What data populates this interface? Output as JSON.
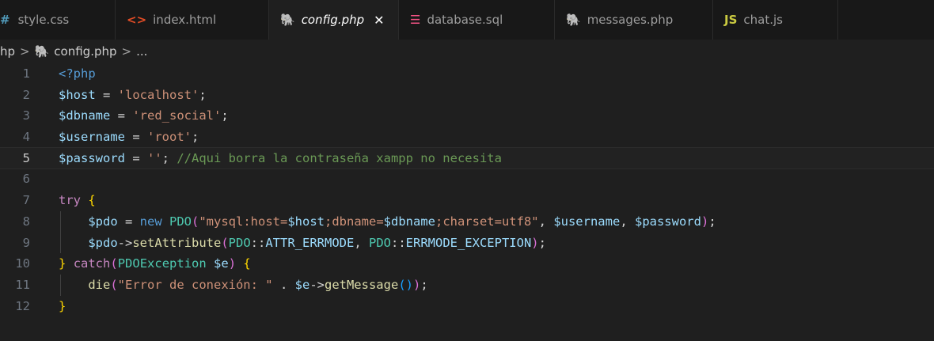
{
  "tabs": [
    {
      "label": "style.css",
      "icon": "css-hash-icon",
      "icon_text": "#",
      "icon_color": "#519aba"
    },
    {
      "label": "index.html",
      "icon": "html-brackets-icon",
      "icon_text": "<>",
      "icon_color": "#e44d26"
    },
    {
      "label": "config.php",
      "icon": "php-elephant-icon",
      "icon_text": "🐘",
      "icon_color": "#a074c4",
      "active": true,
      "close": "✕"
    },
    {
      "label": "database.sql",
      "icon": "database-icon",
      "icon_text": "☰",
      "icon_color": "#f55385"
    },
    {
      "label": "messages.php",
      "icon": "php-elephant-icon",
      "icon_text": "🐘",
      "icon_color": "#a074c4"
    },
    {
      "label": "chat.js",
      "icon": "js-icon",
      "icon_text": "JS",
      "icon_color": "#cbcb41"
    }
  ],
  "breadcrumb": {
    "parent": "hp",
    "file": "config.php",
    "tail": "...",
    "separator": ">"
  },
  "editor": {
    "current_line": 5,
    "lines": [
      {
        "n": "1",
        "t": [
          [
            "<?php",
            "kw"
          ]
        ]
      },
      {
        "n": "2",
        "t": [
          [
            "$host",
            "var"
          ],
          [
            " = ",
            "pun"
          ],
          [
            "'localhost'",
            "str"
          ],
          [
            ";",
            "pun"
          ]
        ]
      },
      {
        "n": "3",
        "t": [
          [
            "$dbname",
            "var"
          ],
          [
            " = ",
            "pun"
          ],
          [
            "'red_social'",
            "str"
          ],
          [
            ";",
            "pun"
          ]
        ]
      },
      {
        "n": "4",
        "t": [
          [
            "$username",
            "var"
          ],
          [
            " = ",
            "pun"
          ],
          [
            "'root'",
            "str"
          ],
          [
            ";",
            "pun"
          ]
        ]
      },
      {
        "n": "5",
        "t": [
          [
            "$password",
            "var"
          ],
          [
            " = ",
            "pun"
          ],
          [
            "''",
            "str"
          ],
          [
            "; ",
            "pun"
          ],
          [
            "//Aqui borra la contraseña xampp no necesita",
            "cmt"
          ]
        ]
      },
      {
        "n": "6",
        "t": []
      },
      {
        "n": "7",
        "t": [
          [
            "try",
            "ctl"
          ],
          [
            " ",
            "pun"
          ],
          [
            "{",
            "br1"
          ]
        ]
      },
      {
        "n": "8",
        "g": true,
        "t": [
          [
            "    ",
            "pun"
          ],
          [
            "$pdo",
            "var"
          ],
          [
            " = ",
            "pun"
          ],
          [
            "new",
            "kw"
          ],
          [
            " ",
            "pun"
          ],
          [
            "PDO",
            "cls"
          ],
          [
            "(",
            "br2"
          ],
          [
            "\"mysql:host=",
            "str"
          ],
          [
            "$host",
            "var"
          ],
          [
            ";dbname=",
            "str"
          ],
          [
            "$dbname",
            "var"
          ],
          [
            ";charset=utf8\"",
            "str"
          ],
          [
            ", ",
            "pun"
          ],
          [
            "$username",
            "var"
          ],
          [
            ", ",
            "pun"
          ],
          [
            "$password",
            "var"
          ],
          [
            ")",
            "br2"
          ],
          [
            ";",
            "pun"
          ]
        ]
      },
      {
        "n": "9",
        "g": true,
        "t": [
          [
            "    ",
            "pun"
          ],
          [
            "$pdo",
            "var"
          ],
          [
            "->",
            "pun"
          ],
          [
            "setAttribute",
            "fn"
          ],
          [
            "(",
            "br2"
          ],
          [
            "PDO",
            "cls"
          ],
          [
            "::",
            "pun"
          ],
          [
            "ATTR_ERRMODE",
            "var"
          ],
          [
            ", ",
            "pun"
          ],
          [
            "PDO",
            "cls"
          ],
          [
            "::",
            "pun"
          ],
          [
            "ERRMODE_EXCEPTION",
            "var"
          ],
          [
            ")",
            "br2"
          ],
          [
            ";",
            "pun"
          ]
        ]
      },
      {
        "n": "10",
        "t": [
          [
            "}",
            "br1"
          ],
          [
            " ",
            "pun"
          ],
          [
            "catch",
            "ctl"
          ],
          [
            "(",
            "br2"
          ],
          [
            "PDOException",
            "cls"
          ],
          [
            " ",
            "pun"
          ],
          [
            "$e",
            "var"
          ],
          [
            ")",
            "br2"
          ],
          [
            " ",
            "pun"
          ],
          [
            "{",
            "br1"
          ]
        ]
      },
      {
        "n": "11",
        "g": true,
        "t": [
          [
            "    ",
            "pun"
          ],
          [
            "die",
            "fn"
          ],
          [
            "(",
            "br2"
          ],
          [
            "\"Error de conexión: \"",
            "str"
          ],
          [
            " . ",
            "pun"
          ],
          [
            "$e",
            "var"
          ],
          [
            "->",
            "pun"
          ],
          [
            "getMessage",
            "fn"
          ],
          [
            "(",
            "br3"
          ],
          [
            ")",
            "br3"
          ],
          [
            ")",
            "br2"
          ],
          [
            ";",
            "pun"
          ]
        ]
      },
      {
        "n": "12",
        "t": [
          [
            "}",
            "br1"
          ]
        ]
      }
    ]
  }
}
